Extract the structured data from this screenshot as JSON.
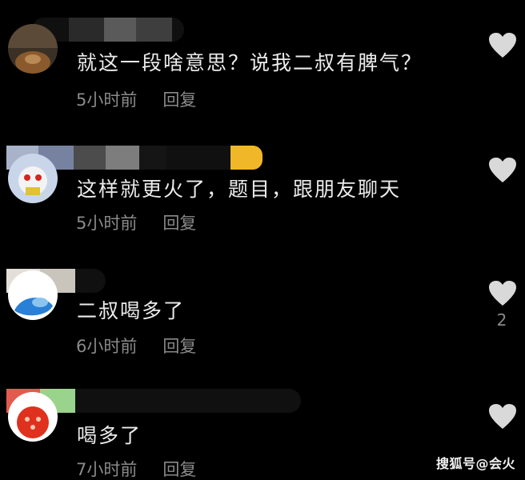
{
  "comments": [
    {
      "text": "就这一段啥意思？说我二叔有脾气？",
      "time": "5小时前",
      "reply": "回复",
      "like_count": ""
    },
    {
      "text": "这样就更火了，题目，跟朋友聊天",
      "time": "5小时前",
      "reply": "回复",
      "like_count": ""
    },
    {
      "text": "二叔喝多了",
      "time": "6小时前",
      "reply": "回复",
      "like_count": "2"
    },
    {
      "text": "喝多了",
      "time": "7小时前",
      "reply": "回复",
      "like_count": ""
    }
  ],
  "watermark": "搜狐号@会火",
  "icons": {
    "like": "heart-icon"
  },
  "colors": {
    "background": "#000000",
    "comment_text": "#ececec",
    "meta_text": "#8a8a8a",
    "like_icon": "#d9d9d9"
  }
}
